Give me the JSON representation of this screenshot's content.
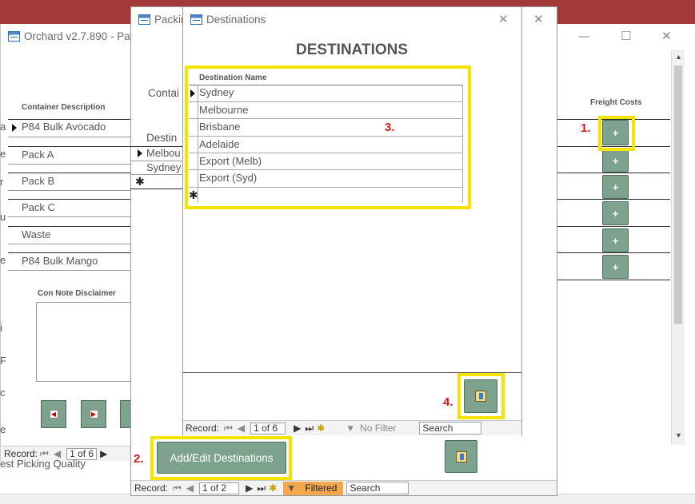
{
  "back_window": {
    "title": "Orchard v2.7.890 - Pac",
    "header_container": "Container Description",
    "header_freight": "Freight Costs",
    "rows": [
      "P84 Bulk Avocado",
      "Pack A",
      "Pack B",
      "Pack C",
      "Waste",
      "P84 Bulk Mango"
    ],
    "plus_label": "+",
    "con_note_label": "Con Note Disclaimer",
    "record_label": "Record:",
    "record_value": "1 of 6",
    "left_edge_chars": [
      "a",
      "e",
      "r",
      "u",
      "e",
      "i",
      "F",
      "c",
      "e"
    ],
    "bottom_text": "est Picking Quality"
  },
  "middle_window": {
    "title": "Packir",
    "label_container": "Contai",
    "label_destin": "Destin",
    "list_items": [
      "Melbou",
      "Sydney"
    ],
    "add_edit_button": "Add/Edit Destinations",
    "record_label": "Record:",
    "record_value": "1 of 2",
    "filtered": "Filtered",
    "search": "Search"
  },
  "destinations_window": {
    "title": "Destinations",
    "heading": "DESTINATIONS",
    "column_header": "Destination Name",
    "rows": [
      "Sydney",
      "Melbourne",
      "Brisbane",
      "Adelaide",
      "Export (Melb)",
      "Export (Syd)"
    ],
    "record_label": "Record:",
    "record_value": "1 of 6",
    "no_filter": "No Filter",
    "search": "Search"
  },
  "annotations": {
    "label1": "1.",
    "label2": "2.",
    "label3": "3.",
    "label4": "4.",
    "highlight_color": "#f5e400",
    "label_color": "#d31b1b"
  },
  "icons": [
    "access-form-icon",
    "close-icon",
    "minimize-icon",
    "maximize-icon",
    "record-selector-icon",
    "new-record-icon",
    "exit-door-icon",
    "filter-icon",
    "first-record-icon",
    "prev-record-icon",
    "next-record-icon",
    "last-record-icon"
  ]
}
